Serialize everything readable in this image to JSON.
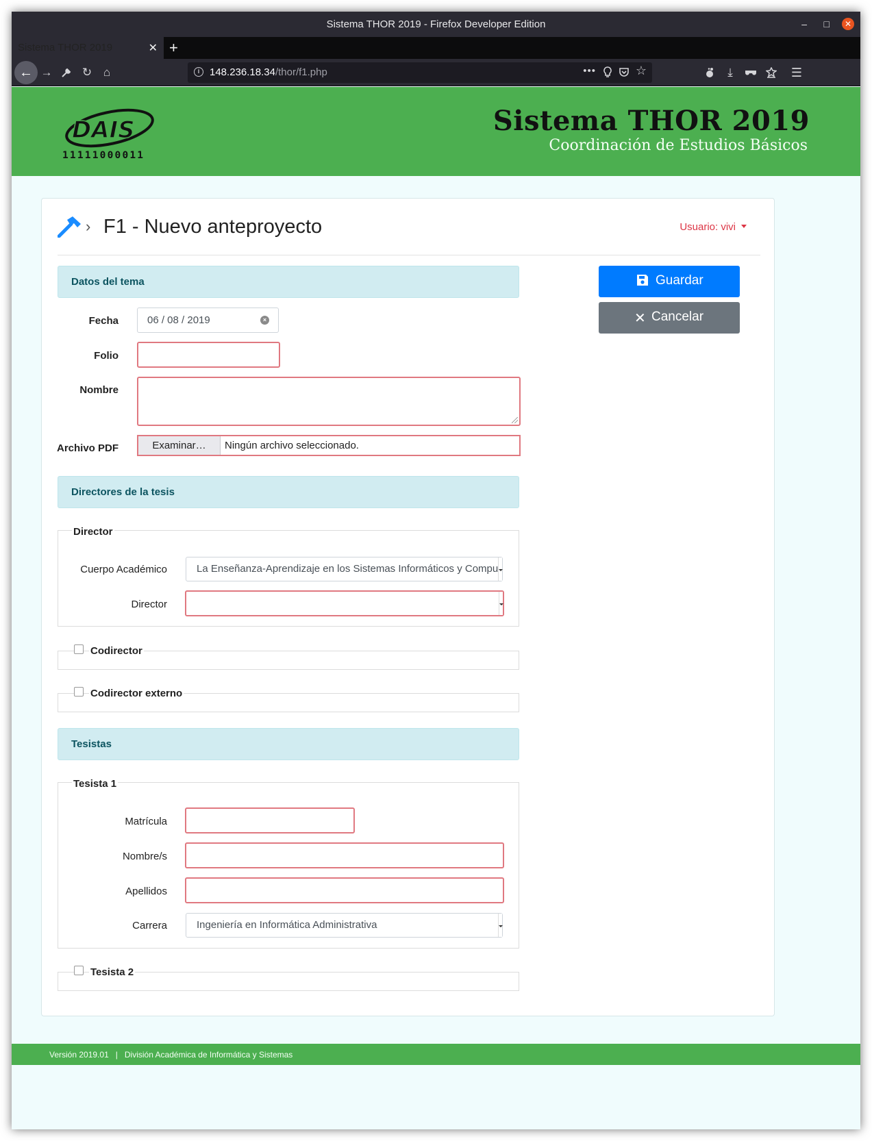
{
  "window": {
    "title": "Sistema THOR 2019 - Firefox Developer Edition",
    "minimize": "–",
    "maximize": "□",
    "close": "✕"
  },
  "tab": {
    "label": "Sistema THOR 2019",
    "close": "✕",
    "new_tab": "+"
  },
  "nav": {
    "url_host": "148.236.18.34",
    "url_path": "/thor/f1.php",
    "icons": [
      "back-icon",
      "forward-icon",
      "wrench-icon",
      "reload-icon",
      "home-icon",
      "info-icon",
      "more-icon",
      "lightbulb-icon",
      "pocket-icon",
      "bookmark-star-icon",
      "gnome-icon",
      "download-icon",
      "mask-icon",
      "library-icon",
      "menu-icon"
    ]
  },
  "banner": {
    "logo_text": "DAIS",
    "logo_digits": "11111000011",
    "title": "Sistema THOR 2019",
    "subtitle": "Coordinación de Estudios Básicos"
  },
  "header": {
    "icon": "hammer-icon",
    "title": "F1 - Nuevo anteproyecto",
    "user_label": "Usuario: vivi"
  },
  "sections": {
    "tema": "Datos del tema",
    "directores": "Directores de la tesis",
    "tesistas": "Tesistas"
  },
  "tema": {
    "fecha_label": "Fecha",
    "fecha_value": "06 / 08 / 2019",
    "folio_label": "Folio",
    "folio_value": "",
    "nombre_label": "Nombre",
    "nombre_value": "",
    "pdf_label": "Archivo PDF",
    "pdf_button": "Examinar…",
    "pdf_status": "Ningún archivo seleccionado."
  },
  "director": {
    "legend": "Director",
    "cuerpo_label": "Cuerpo Académico",
    "cuerpo_value": "La Enseñanza-Aprendizaje en los Sistemas Informáticos y Computacionales",
    "director_label": "Director",
    "director_value": ""
  },
  "codirector": {
    "legend": "Codirector",
    "checked": false
  },
  "codirector_externo": {
    "legend": "Codirector externo",
    "checked": false
  },
  "tesista1": {
    "legend": "Tesista 1",
    "matricula_label": "Matrícula",
    "matricula_value": "",
    "nombre_label": "Nombre/s",
    "nombre_value": "",
    "apellidos_label": "Apellidos",
    "apellidos_value": "",
    "carrera_label": "Carrera",
    "carrera_value": "Ingeniería en Informática Administrativa"
  },
  "tesista2": {
    "legend": "Tesista 2",
    "checked": false
  },
  "actions": {
    "save": "Guardar",
    "cancel": "Cancelar"
  },
  "footer": {
    "text": "Versión 2019.01   |   División Académica de Informática y Sistemas"
  },
  "colors": {
    "banner": "#4caf50",
    "primary": "#007bff",
    "secondary": "#6c757d",
    "danger": "#dc3545",
    "section_bg": "#d1ecf1",
    "section_text": "#0c5460"
  }
}
